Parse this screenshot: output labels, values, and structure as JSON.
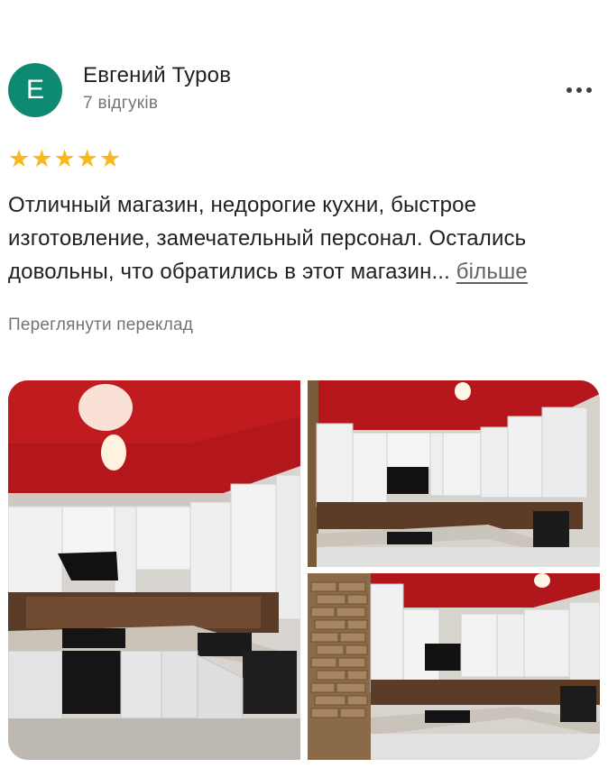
{
  "reviewer": {
    "avatar_letter": "E",
    "name": "Евгений Туров",
    "reviews_count": "7 відгуків"
  },
  "menu": {
    "icon": "more-vertical-icon"
  },
  "review": {
    "rating": 5,
    "text": "Отличный магазин, недорогие кухни, быстрое изготовление,  замечательный персонал. Остались довольны, что обратились в этот магазин...",
    "more_label": "більше",
    "translate_label": "Переглянути переклад"
  },
  "colors": {
    "avatar": "#0f8a72",
    "star": "#f9b820",
    "secondary_text": "#70757a"
  }
}
